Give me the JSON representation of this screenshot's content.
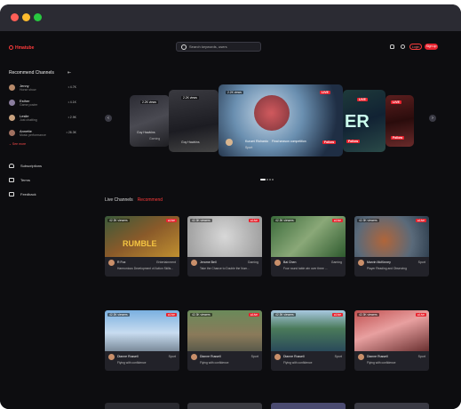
{
  "app": {
    "logo": "Hmatube"
  },
  "search": {
    "placeholder": "Search keywords, users"
  },
  "header": {
    "login": "Login",
    "signup": "Sign up"
  },
  "sidebar": {
    "title": "Recommend Channels",
    "channels": [
      {
        "name": "Jenny",
        "sub": "Horse show",
        "count": "4.7K",
        "color": "#b78a6a"
      },
      {
        "name": "Esther",
        "sub": "Game poster",
        "count": "4.1K",
        "color": "#8a7d9e"
      },
      {
        "name": "Leslie",
        "sub": "Just chatting",
        "count": "2.9K",
        "color": "#c9a27f"
      },
      {
        "name": "Annette",
        "sub": "Music performance",
        "count": "26.3K",
        "color": "#a07060"
      }
    ],
    "see_more": "See more",
    "nav": [
      {
        "label": "Subscriptions"
      },
      {
        "label": "Terms"
      },
      {
        "label": "Feedback"
      }
    ]
  },
  "carousel": {
    "slides": [
      {
        "views": "2.2K views",
        "name": "Guy Hawkins",
        "category": "Gaming"
      },
      {
        "views": "2.2K views",
        "name": "Guy Hawkins"
      },
      {
        "views": "2.2K views",
        "name": "Kurumi Richardo",
        "category": "Sport",
        "title": "Final season competition",
        "live": "LIVE",
        "follow": "Follow"
      },
      {
        "live": "LIVE",
        "follow": "Follow"
      },
      {
        "live": "LIVE",
        "follow": "Follow"
      }
    ]
  },
  "live_section": {
    "title": "Live Channels",
    "recommend": "Recommend"
  },
  "tiles": [
    {
      "views": "42.3K viewers",
      "live": "Live",
      "name": "R Fox",
      "category": "Entertainment",
      "title": "Harmonious Development of Action Skills..."
    },
    {
      "views": "42.3K viewers",
      "live": "Live",
      "name": "Jerome Bell",
      "category": "Gaming",
      "title": "Take the Chance to Double the Num..."
    },
    {
      "views": "42.3K viewers",
      "live": "Live",
      "name": "Bai Chen",
      "category": "Gaming",
      "title": "Four round table win over three ..."
    },
    {
      "views": "42.3K viewers",
      "live": "Live",
      "name": "Marvin McKinney",
      "category": "Sport",
      "title": "Player Reading and Observing"
    },
    {
      "views": "42.3K viewers",
      "live": "Live",
      "name": "Dianne Russell",
      "category": "Sport",
      "title": "Flying with confidence"
    },
    {
      "views": "42.3K viewers",
      "live": "Live",
      "name": "Dianne Russell",
      "category": "Sport",
      "title": "Flying with confidence"
    },
    {
      "views": "42.3K viewers",
      "live": "Live",
      "name": "Dianne Russell",
      "category": "Sport",
      "title": "Flying with confidence"
    },
    {
      "views": "42.3K viewers",
      "live": "Live",
      "name": "Dianne Russell",
      "category": "Sport",
      "title": "Flying with confidence"
    }
  ]
}
